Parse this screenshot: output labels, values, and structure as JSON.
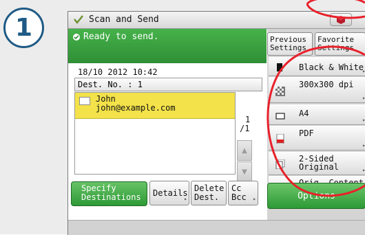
{
  "step_number": "1",
  "screen": {
    "title": "Scan and Send",
    "status": "Ready to send.",
    "datetime": "18/10 2012 10:42",
    "dest_no": "Dest. No.  : 1",
    "destination": {
      "name": "John",
      "email": "john@example.com"
    },
    "page_counter": {
      "current": "1",
      "total": "/1"
    }
  },
  "right_panel": {
    "previous_settings": "Previous Settings",
    "favorite_settings": "Favorite Settings",
    "settings": [
      {
        "label": "Black & White",
        "icon": "color-mode-icon"
      },
      {
        "label": "300x300 dpi",
        "icon": "resolution-icon"
      },
      {
        "label": "A4",
        "icon": "paper-size-icon"
      },
      {
        "label": "PDF",
        "icon": "pdf-file-icon"
      },
      {
        "label": "2-Sided Original",
        "icon": "two-sided-icon"
      },
      {
        "label": "Orig. Content Orientation",
        "icon": "orientation-icon"
      }
    ],
    "options": "Options"
  },
  "bottom_buttons": {
    "specify": "Specify Destinations",
    "details": "Details",
    "delete": "Delete Dest.",
    "ccbcc": "Cc Bcc"
  },
  "colors": {
    "accent_green": "#2f8e36",
    "highlight_yellow": "#f3e24a",
    "annotation_red": "#e8202a",
    "step_blue": "#1e5a85"
  }
}
